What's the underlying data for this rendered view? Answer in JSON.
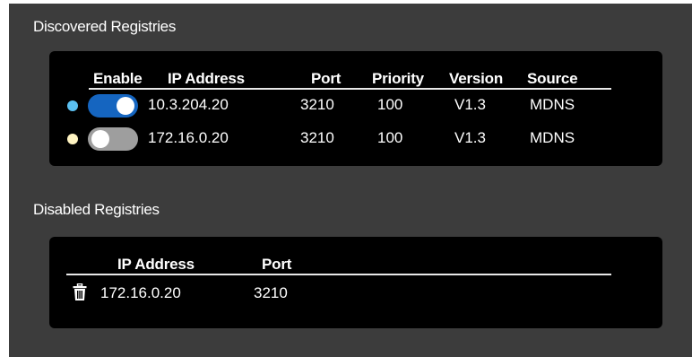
{
  "discovered": {
    "title": "Discovered Registries",
    "headers": {
      "enable": "Enable",
      "ip": "IP Address",
      "port": "Port",
      "priority": "Priority",
      "version": "Version",
      "source": "Source"
    },
    "rows": [
      {
        "status_color": "#5bc0f0",
        "enabled": true,
        "ip": "10.3.204.20",
        "port": "3210",
        "priority": "100",
        "version": "V1.3",
        "source": "MDNS"
      },
      {
        "status_color": "#fff4c2",
        "enabled": false,
        "ip": "172.16.0.20",
        "port": "3210",
        "priority": "100",
        "version": "V1.3",
        "source": "MDNS"
      }
    ]
  },
  "disabled": {
    "title": "Disabled Registries",
    "headers": {
      "ip": "IP Address",
      "port": "Port"
    },
    "rows": [
      {
        "icon": "trash-icon",
        "ip": "172.16.0.20",
        "port": "3210"
      }
    ]
  },
  "colors": {
    "toggle_on": "#1565c0",
    "toggle_off": "#9e9e9e"
  }
}
